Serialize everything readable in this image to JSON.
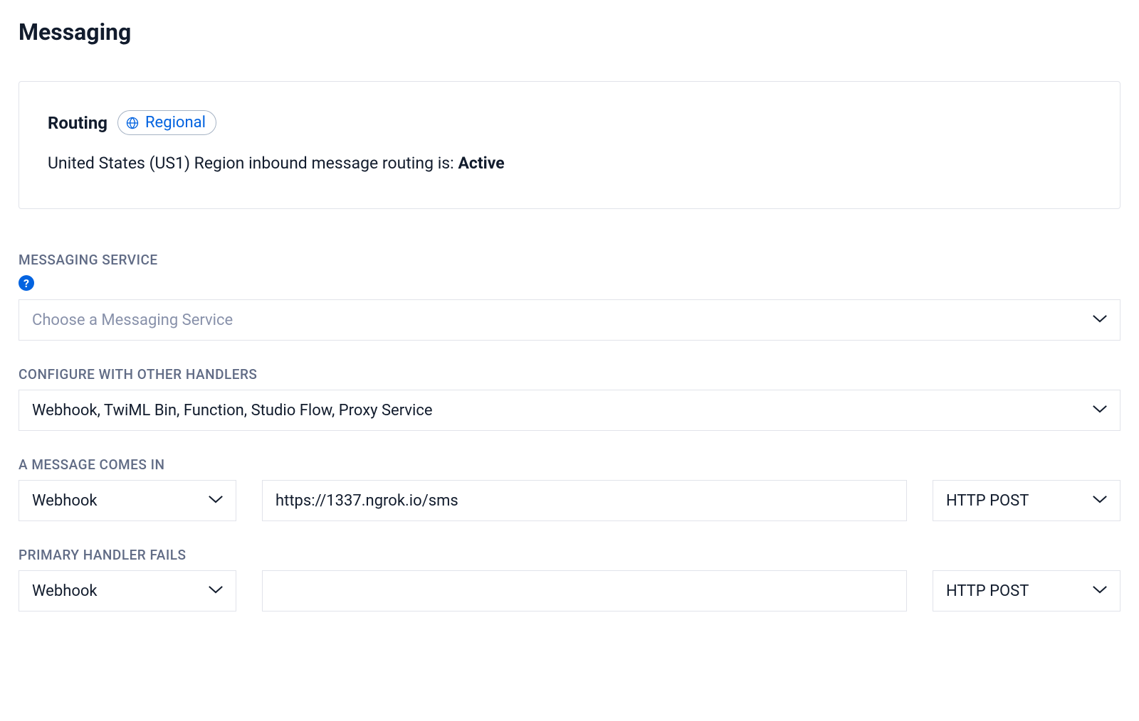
{
  "page": {
    "title": "Messaging"
  },
  "routing": {
    "section_title": "Routing",
    "badge_label": "Regional",
    "status_prefix": "United States (US1) Region inbound message routing is: ",
    "status_value": "Active"
  },
  "messaging_service": {
    "label": "MESSAGING SERVICE",
    "placeholder": "Choose a Messaging Service",
    "help_icon_char": "?"
  },
  "other_handlers": {
    "label": "CONFIGURE WITH OTHER HANDLERS",
    "value": "Webhook, TwiML Bin, Function, Studio Flow, Proxy Service"
  },
  "message_comes_in": {
    "label": "A MESSAGE COMES IN",
    "handler": "Webhook",
    "url": "https://1337.ngrok.io/sms",
    "method": "HTTP POST"
  },
  "primary_handler_fails": {
    "label": "PRIMARY HANDLER FAILS",
    "handler": "Webhook",
    "url": "",
    "method": "HTTP POST"
  }
}
